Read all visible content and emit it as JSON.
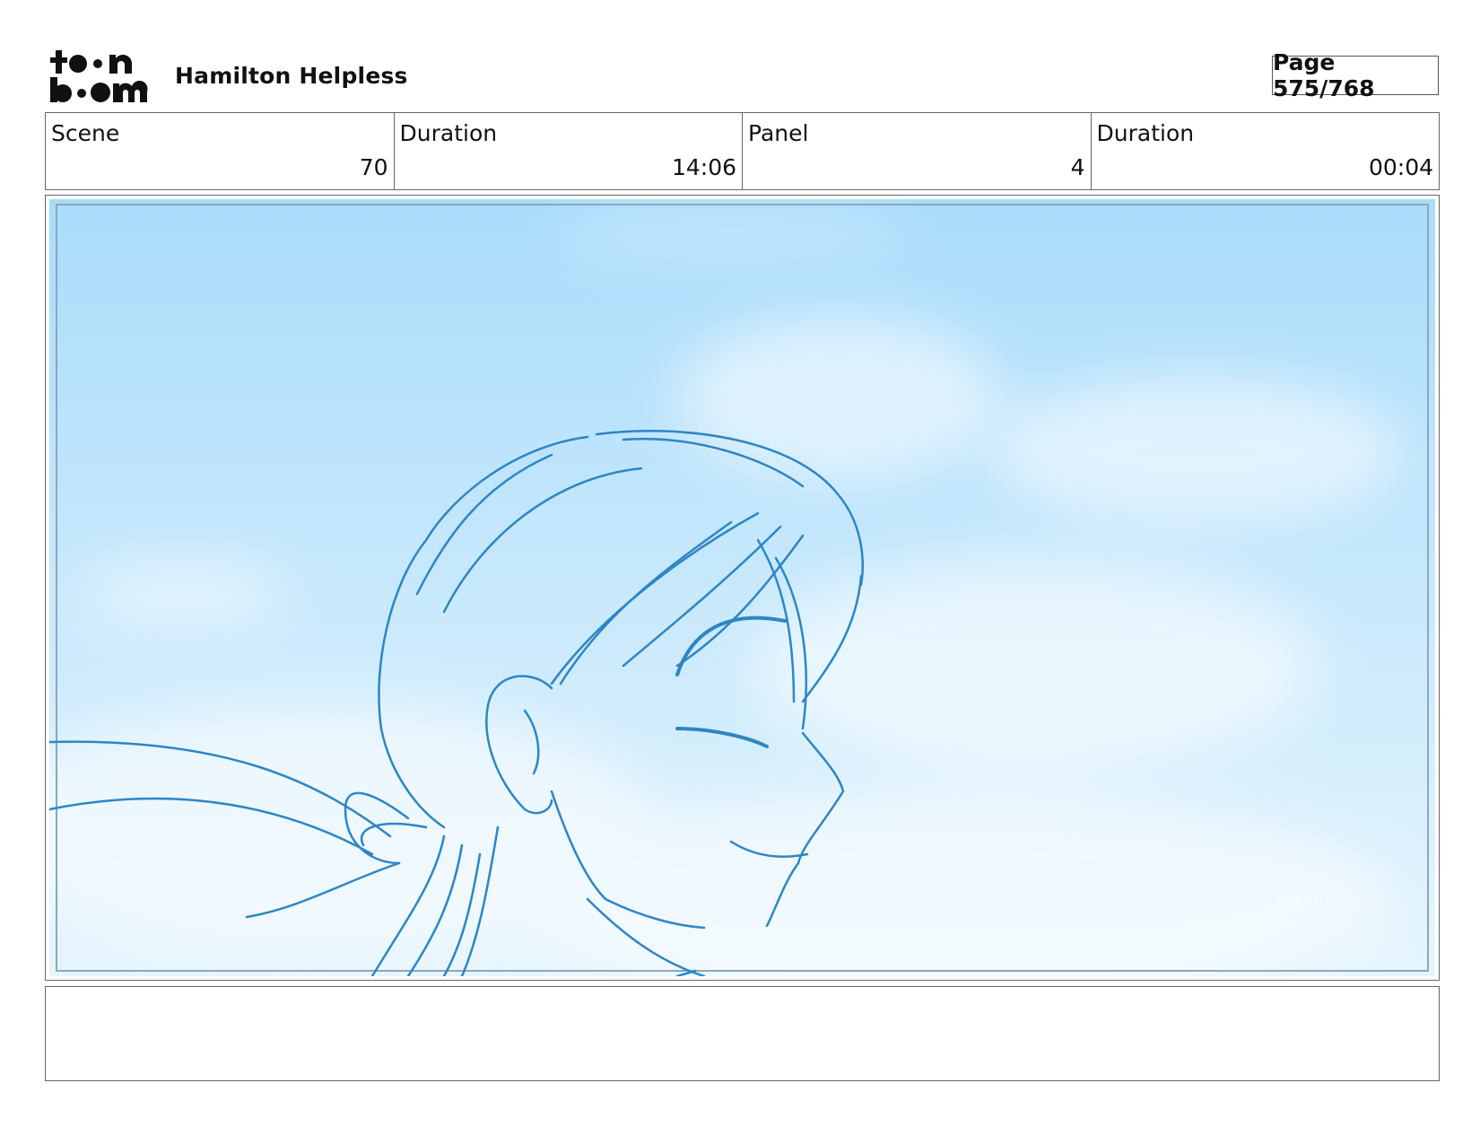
{
  "header": {
    "logo_text": "toon boom",
    "project_title": "Hamilton Helpless",
    "page_label": "Page 575/768"
  },
  "info": {
    "scene_label": "Scene",
    "scene_value": "70",
    "scene_duration_label": "Duration",
    "scene_duration_value": "14:06",
    "panel_label": "Panel",
    "panel_value": "4",
    "panel_duration_label": "Duration",
    "panel_duration_value": "00:04"
  },
  "panel": {
    "description": "",
    "sky_top_color": "#a9dcfb",
    "sky_bottom_color": "#e6f5fd",
    "line_color": "#2d86c6"
  },
  "notes": {
    "text": ""
  }
}
